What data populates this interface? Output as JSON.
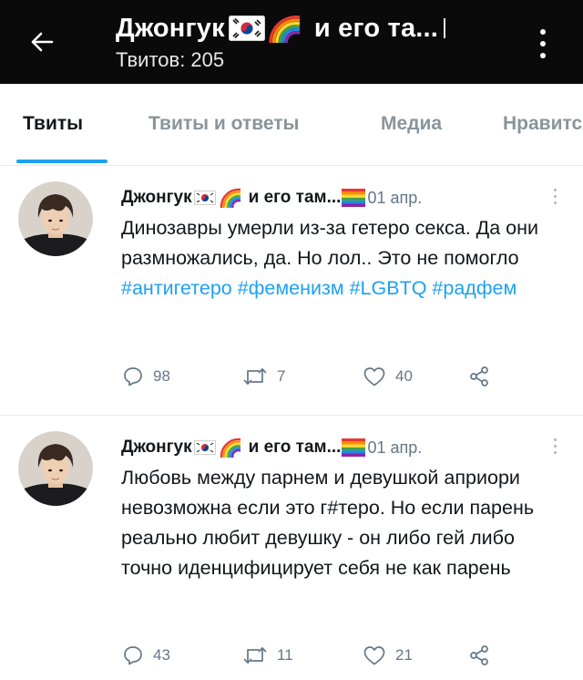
{
  "header": {
    "title_name": "Джонгук",
    "title_tail": "и его та...",
    "subtitle": "Твитов: 205",
    "icons": {
      "back": "arrow-left-icon",
      "more": "more-vertical-icon"
    },
    "colors": {
      "background": "#0a0a0a",
      "text": "#ffffff"
    }
  },
  "tabs": [
    {
      "label": "Твиты",
      "active": true
    },
    {
      "label": "Твиты и ответы",
      "active": false
    },
    {
      "label": "Медиа",
      "active": false
    },
    {
      "label": "Нравится",
      "active": false
    }
  ],
  "accent_color": "#1da1f2",
  "tweets": [
    {
      "author_name": "Джонгук",
      "author_tail": "и его там...",
      "date": "01 апр.",
      "text_plain_1": "Динозавры умерли из-за гетеро секса. Да они размножались, да. Но лол.. Это не помогло ",
      "hashtag_1": "#антигетеро",
      "hashtag_2": "#феменизм",
      "hashtag_3": "#LGBTQ",
      "hashtag_4": "#радфем",
      "replies": "98",
      "retweets": "7",
      "likes": "40"
    },
    {
      "author_name": "Джонгук",
      "author_tail": "и его там...",
      "date": "01 апр.",
      "text": "Любовь между парнем и девушкой априори невозможна если это г#теро. Но если парень реально любит девушку - он либо гей либо точно иденцифицирует себя не как парень",
      "replies": "43",
      "retweets": "11",
      "likes": "21"
    }
  ]
}
